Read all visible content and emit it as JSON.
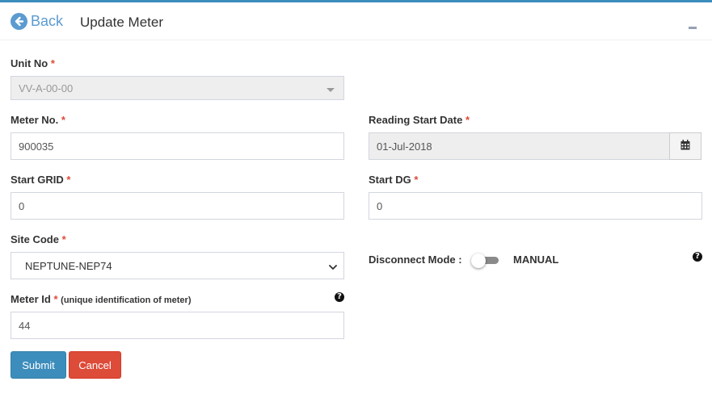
{
  "header": {
    "back_label": "Back",
    "title": "Update Meter"
  },
  "form": {
    "unit_no": {
      "label": "Unit No",
      "required_mark": "*",
      "value": "VV-A-00-00"
    },
    "meter_no": {
      "label": "Meter No.",
      "required_mark": "*",
      "value": "900035"
    },
    "reading_start_date": {
      "label": "Reading Start Date",
      "required_mark": "*",
      "value": "01-Jul-2018"
    },
    "start_grid": {
      "label": "Start GRID",
      "required_mark": "*",
      "value": "0"
    },
    "start_dg": {
      "label": "Start DG",
      "required_mark": "*",
      "value": "0"
    },
    "site_code": {
      "label": "Site Code",
      "required_mark": "*",
      "value": "NEPTUNE-NEP74"
    },
    "disconnect_mode": {
      "label": "Disconnect Mode :",
      "state_label": "MANUAL",
      "help": "?"
    },
    "meter_id": {
      "label": "Meter Id",
      "required_mark": "*",
      "hint": "(unique identification of meter)",
      "value": "44",
      "help": "?"
    }
  },
  "actions": {
    "submit_label": "Submit",
    "cancel_label": "Cancel"
  },
  "icons": {
    "back": "arrow-circle-left-icon",
    "collapse": "minus-icon",
    "calendar": "calendar-icon",
    "help": "question-circle-icon",
    "dropdown": "caret-down-icon"
  },
  "colors": {
    "accent": "#3c8dbc",
    "danger": "#dd4b39",
    "back_link": "#5b9bd1"
  }
}
